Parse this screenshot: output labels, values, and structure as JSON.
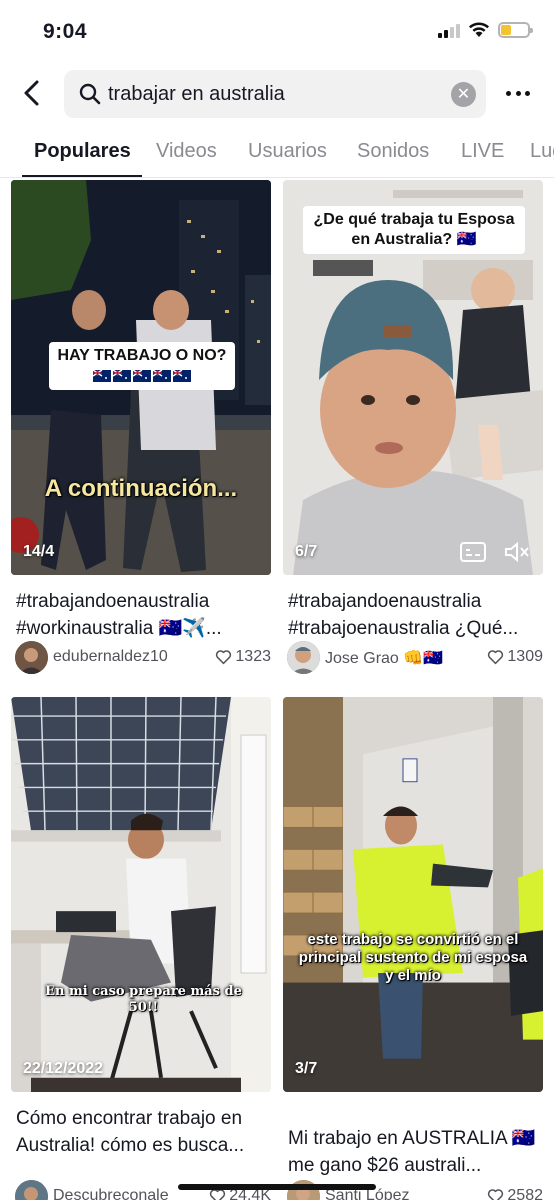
{
  "status_bar": {
    "time": "9:04"
  },
  "search": {
    "value": "trabajar en australia"
  },
  "tabs": [
    {
      "label": "Populares"
    },
    {
      "label": "Videos"
    },
    {
      "label": "Usuarios"
    },
    {
      "label": "Sonidos"
    },
    {
      "label": "LIVE"
    },
    {
      "label": "Lug"
    }
  ],
  "videos": [
    {
      "badge": "14/4",
      "overlay_label": "HAY TRABAJO O NO?",
      "overlay_text": "A continuación...",
      "description": "#trabajandoenaustralia #workinaustralia 🇦🇺✈️...",
      "author": "edubernaldez10",
      "likes": "1323"
    },
    {
      "badge": "6/7",
      "overlay_label": "¿De qué trabaja tu Esposa en Australia? 🇦🇺",
      "description": "#trabajandoenaustralia #trabajoenaustralia ¿Qué...",
      "author": "Jose Grao 👊🇦🇺",
      "likes": "1309"
    },
    {
      "badge": "22/12/2022",
      "overlay_text": "En mi caso prepare más de 50!!",
      "description": "Cómo encontrar trabajo en Australia! cómo es busca...",
      "author": "Descubreconale",
      "likes": "24.4K"
    },
    {
      "badge": "3/7",
      "overlay_text": "este trabajo se convirtió en el principal sustento de mi esposa y el mío",
      "description": "Mi trabajo en AUSTRALIA 🇦🇺 me gano $26 australi...",
      "author": "Santi López",
      "likes": "2582"
    }
  ],
  "colors": {
    "text": "#161823",
    "muted": "#8a8b91",
    "search_bg": "#f1f1f2",
    "battery": "#f4c430"
  }
}
